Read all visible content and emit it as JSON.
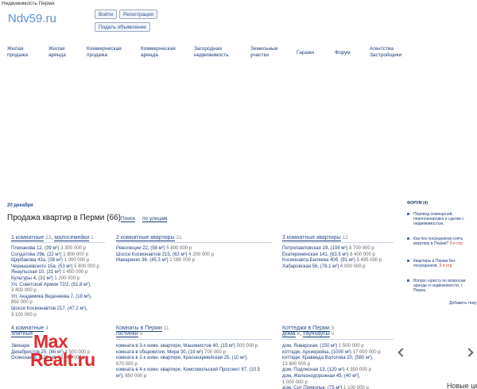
{
  "header": {
    "site_caption": "Недвижимость Перми",
    "logo": "Ndv59.ru",
    "login_label": "Войти",
    "register_label": "Регистрация",
    "add_ad_label": "Подать объявление"
  },
  "nav": {
    "items": [
      {
        "line1": "Жилая",
        "line2": "продажа"
      },
      {
        "line1": "Жилая",
        "line2": "аренда"
      },
      {
        "line1": "Коммерческая",
        "line2": "продажа"
      },
      {
        "line1": "Коммерческая",
        "line2": "аренда"
      },
      {
        "line1": "Загородная",
        "line2": "недвижимость"
      },
      {
        "line1": "Земельные",
        "line2": "участки"
      },
      {
        "line1": "Гаражи",
        "line2": ""
      },
      {
        "line1": "Форум",
        "line2": ""
      },
      {
        "line1": "Агентства",
        "line2": "Застройщики"
      }
    ]
  },
  "main": {
    "date": "20 декабря",
    "title": "Продажа квартир в Перми (66)",
    "tab_search": "Поиск",
    "tab_by_street": "по улицам",
    "categories": [
      {
        "label": "1 комнатные",
        "count": "23",
        "sub_label": "малосемейки",
        "sub_count": "1",
        "items": [
          {
            "t": "Плеханова 12, (39 м²)",
            "p": "3 300 000 р"
          },
          {
            "t": "Солдатова 29в, (22 м²)",
            "p": "1 800 000 р"
          },
          {
            "t": "Щербакова 43а, (38 м²)",
            "p": "1 000 000 р"
          },
          {
            "t": "Чернышевского 15а, (53 м²)",
            "p": "5 800 000 р"
          },
          {
            "t": "Янаульская 10, (31 м²)",
            "p": "1 450 000 р"
          },
          {
            "t": "Культуры 4, (31 м²)",
            "p": "1 200 000 р"
          },
          {
            "t": "Ул. Советской Армии 72/2, (51.8 м²),",
            "p": ""
          },
          {
            "t": "",
            "p": "3 400 000 р"
          },
          {
            "t": "Ул. Академика Веденеева 7, (18 м²),",
            "p": ""
          },
          {
            "t": "",
            "p": "850 000 р"
          },
          {
            "t": "Шоссе Космонавтов 217, (47.2 м²),",
            "p": ""
          },
          {
            "t": "",
            "p": "3 100 000 р"
          }
        ]
      },
      {
        "label": "2 комнатные квартиры",
        "count": "21",
        "sub_label": "",
        "sub_count": "",
        "items": [
          {
            "t": "Революции 22, (58 м²)",
            "p": "5 800 000 р"
          },
          {
            "t": "Шоссе Космонавтов 215, (62 м²)",
            "p": "4 200 000 р"
          },
          {
            "t": "Макаренко 36, (45.3 м²)",
            "p": "2 090 000 р"
          }
        ]
      },
      {
        "label": "3 комнатные квартиры",
        "count": "12",
        "sub_label": "",
        "sub_count": "",
        "items": [
          {
            "t": "Петропавловская 19, (108 м²)",
            "p": "8 700 000 р"
          },
          {
            "t": "Екатерининская 141, (83.5 м²)",
            "p": "6 400 000 р"
          },
          {
            "t": "Космонавта Беляева 40б, (91 м²)",
            "p": "5 495 000 р"
          },
          {
            "t": "Хабаровская 56, (78.1 м²)",
            "p": "4 000 000 р"
          }
        ]
      },
      {
        "label": "4 комнатные",
        "count": "4",
        "sub_label": "элитные",
        "sub_count": "",
        "items": [
          {
            "t": "Звонаре",
            "p": ""
          },
          {
            "t": "Декабристов 25, (86 м²)",
            "p": "4 500 000 р"
          },
          {
            "t": "Осинская 8, (128 м²)",
            "p": "13 900 000 р"
          }
        ]
      },
      {
        "label": "Комнаты в Перми",
        "count": "11",
        "sub_label": "гостинки",
        "sub_count": "8",
        "items": [
          {
            "t": "комната в 3-х комн. квартире, Машинистов 40, (15 м²)",
            "p": "500 000 р"
          },
          {
            "t": "комната в общежитии, Мира 30, (19 м²)",
            "p": "700 000 р"
          },
          {
            "t": "комната в 2-х комн. квартире, Красноармейская 25, (10 м²),",
            "p": ""
          },
          {
            "t": "",
            "p": "870 000 р"
          },
          {
            "t": "комната в 4-х комн. квартире, Комсомольский Проспект 87, (10.5",
            "p": ""
          },
          {
            "t": "м²),",
            "p": "650 000 р"
          }
        ]
      },
      {
        "label": "Коттеджи в Перми",
        "count": "9",
        "sub_label": "дома",
        "sub_count": "6",
        "sub2_label": "таунхаусы",
        "sub2_count": "0",
        "items": [
          {
            "t": "дом, Январская, (150 м²)",
            "p": "1 500 000 р"
          },
          {
            "t": "коттедж, Архиерейка, (1000 м²)",
            "p": "17 000 000 р"
          },
          {
            "t": "коттедж, Кравведа Вологова 20, (580 м²),",
            "p": ""
          },
          {
            "t": "",
            "p": "13 800 000 р"
          },
          {
            "t": "дом, Подлесная 13, (120 м²)",
            "p": "4 350 000 р"
          },
          {
            "t": "дом, Железнодорожная 45, (40 м²),",
            "p": ""
          },
          {
            "t": "",
            "p": "1 000 000 р"
          },
          {
            "t": "дом, Снт Приволье, (75 м²)",
            "p": "1 100 000 р"
          }
        ]
      }
    ]
  },
  "sidebar": {
    "title": "ФОРУМ (4)",
    "items": [
      {
        "text": "Перевод помещений, перепланировка и сделки с недвижимостью.",
        "tail": ""
      },
      {
        "text": "Как без посредников снять квартиру в Перми?",
        "tail": "3-я стр"
      },
      {
        "text": "Квартиры в Перми без посредников.",
        "tail": "3-я стр"
      },
      {
        "text": "Вопрос юристу по вопросам аренды и недвижимости, г. Пермь.",
        "tail": ""
      }
    ],
    "add_topic": "Добавить тему"
  },
  "overlay": {
    "watermark_max": "Max",
    "watermark_realt": "Realt.ru",
    "caption": "Новые цены"
  },
  "colors": {
    "link": "#1e3f7a",
    "logo": "#5a8fd8",
    "watermark": "#e02b2b"
  }
}
